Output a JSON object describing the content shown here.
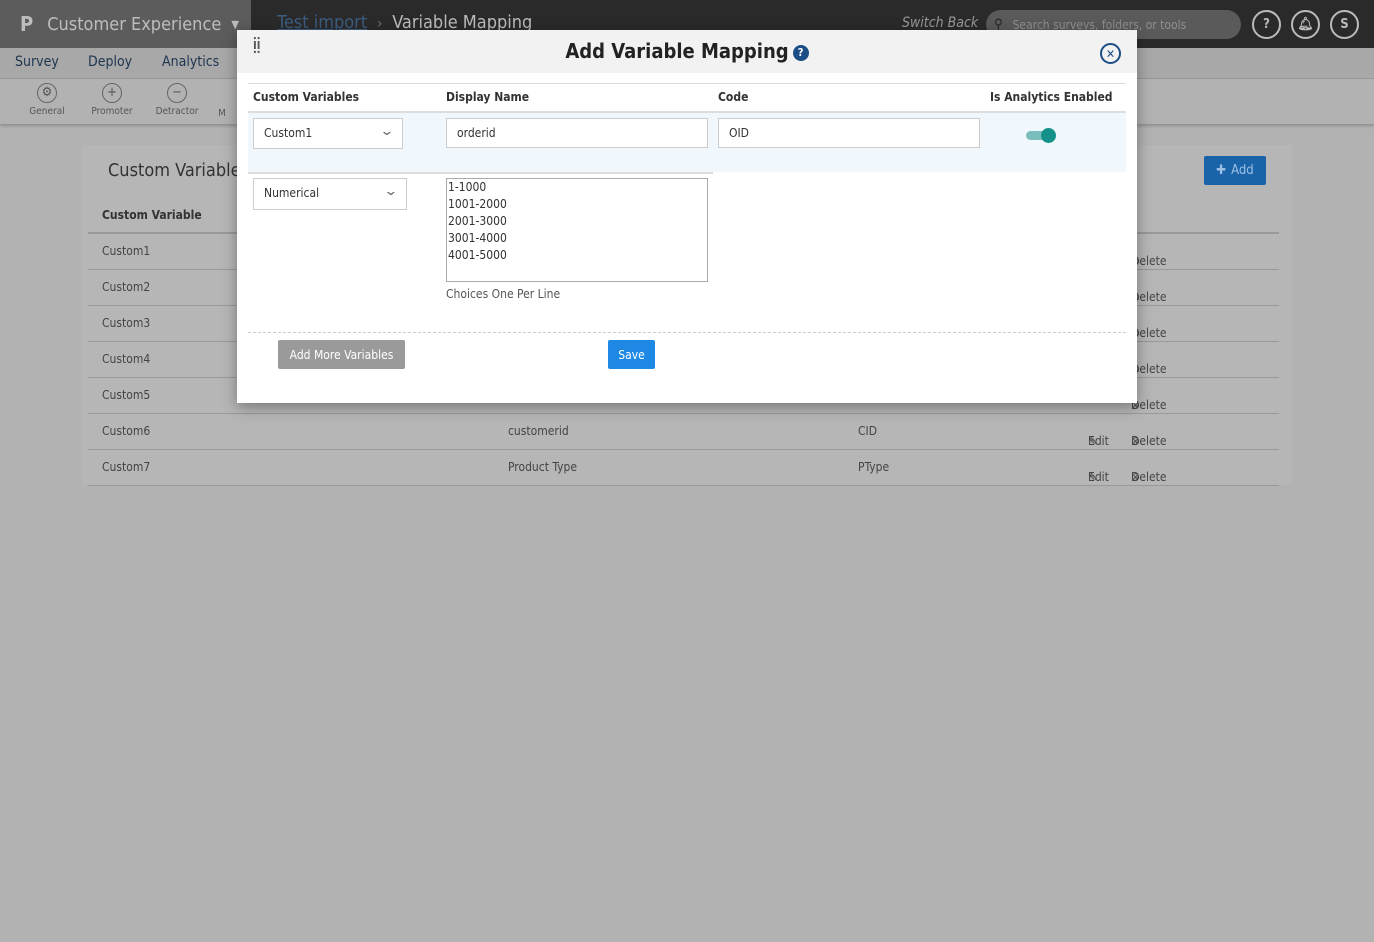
{
  "header": {
    "app_title": "Customer Experience",
    "breadcrumb": [
      {
        "label": "Test import"
      },
      {
        "label": "Variable Mapping"
      }
    ],
    "switch_back": "Switch Back",
    "search_placeholder": "Search surveys, folders, or tools",
    "help": "?",
    "user_initial": "S"
  },
  "nav": {
    "items": [
      "Survey",
      "Deploy",
      "Analytics"
    ]
  },
  "toolbar": {
    "items": [
      "General",
      "Promoter",
      "Detractor",
      "M"
    ]
  },
  "card": {
    "title": "Custom Variable",
    "add_label": "Add",
    "header": "Custom Variable",
    "rows": [
      {
        "var": "Custom1",
        "name": "",
        "code": ""
      },
      {
        "var": "Custom2",
        "name": "",
        "code": ""
      },
      {
        "var": "Custom3",
        "name": "",
        "code": ""
      },
      {
        "var": "Custom4",
        "name": "",
        "code": ""
      },
      {
        "var": "Custom5",
        "name": "",
        "code": ""
      },
      {
        "var": "Custom6",
        "name": "customerid",
        "code": "CID",
        "edit": "Edit"
      },
      {
        "var": "Custom7",
        "name": "Product Type",
        "code": "PType",
        "edit": "Edit"
      }
    ],
    "delete_label": "Delete"
  },
  "modal": {
    "title": "Add Variable Mapping",
    "columns": [
      "Custom Variables",
      "Display Name",
      "Code",
      "Is Analytics Enabled"
    ],
    "variable": "Custom1",
    "display_name": "orderid",
    "code": "OID",
    "analytics_enabled": true,
    "type": "Numerical",
    "choices": [
      "1-1000",
      "1001-2000",
      "2001-3000",
      "3001-4000",
      "4001-5000"
    ],
    "choices_hint": "Choices One Per Line",
    "add_more_label": "Add More Variables",
    "save_label": "Save"
  },
  "colors": {
    "accent": "#1e88e5",
    "toggle": "#14928a",
    "title": "#1c4e86"
  }
}
